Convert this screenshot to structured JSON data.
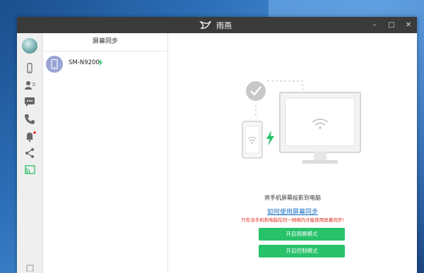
{
  "window": {
    "title": "雨燕",
    "controls": [
      "–",
      "□",
      "✕"
    ]
  },
  "sidebar": {
    "icons": [
      "avatar",
      "phone-icon",
      "contacts-icon",
      "messages-icon",
      "call-icon",
      "notification-icon",
      "share-icon",
      "screen-cast-icon"
    ],
    "active": "screen-cast-icon",
    "notification_dot_color": "#e03020",
    "accent": "#27c269"
  },
  "panel": {
    "header": "屏幕同步",
    "devices": [
      {
        "name": "SM-N9200",
        "charging": true
      }
    ]
  },
  "main": {
    "caption": "将手机屏幕投影到电脑",
    "howto_link": "如何使用屏幕同步",
    "warning": "只有当手机和电脑在同一网络内才能使用屏幕同步!",
    "buttons": {
      "view_mode": "开启观察模式",
      "control_mode": "开启控制模式"
    }
  }
}
